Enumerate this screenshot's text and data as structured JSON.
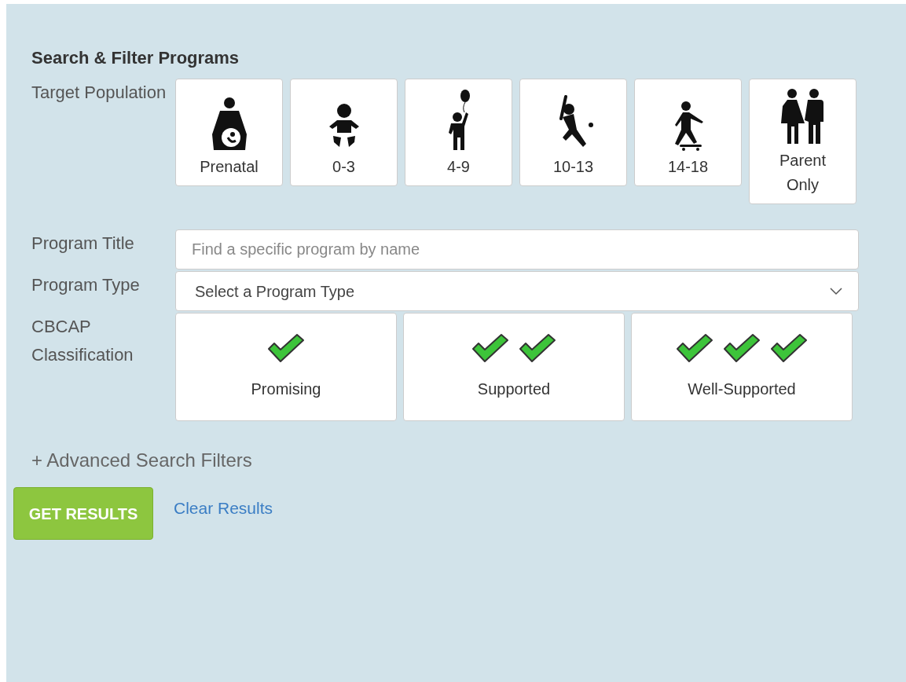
{
  "heading": "Search & Filter Programs",
  "target_population": {
    "label": "Target Population",
    "options": [
      {
        "label": "Prenatal",
        "kind": "prenatal"
      },
      {
        "label": "0-3",
        "kind": "infant"
      },
      {
        "label": "4-9",
        "kind": "child"
      },
      {
        "label": "10-13",
        "kind": "batter"
      },
      {
        "label": "14-18",
        "kind": "skater"
      },
      {
        "label": "Parent Only",
        "kind": "parents"
      }
    ]
  },
  "program_title": {
    "label": "Program Title",
    "placeholder": "Find a specific program by name"
  },
  "program_type": {
    "label": "Program Type",
    "value": "Select a Program Type"
  },
  "classification": {
    "label": "CBCAP Classification",
    "options": [
      {
        "label": "Promising",
        "kind": "single"
      },
      {
        "label": "Supported",
        "kind": "double"
      },
      {
        "label": "Well-Supported",
        "kind": "triple"
      }
    ]
  },
  "advanced_filters": "+ Advanced Search Filters",
  "buttons": {
    "submit": "GET RESULTS",
    "clear": "Clear Results"
  }
}
